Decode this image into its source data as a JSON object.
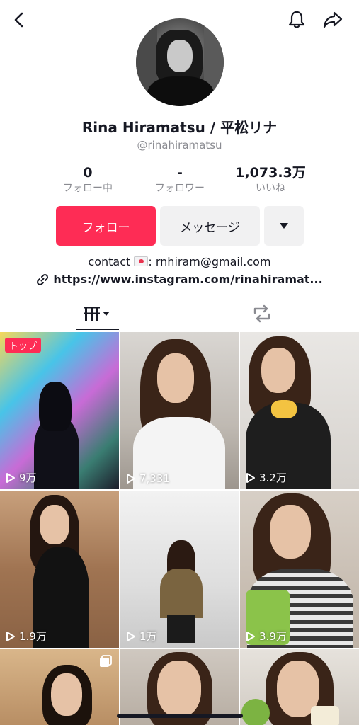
{
  "nav": {
    "back_icon": "chevron-left-icon",
    "bell_icon": "bell-icon",
    "share_icon": "share-icon"
  },
  "profile": {
    "name": "Rina Hiramatsu / 平松リナ",
    "handle": "@rinahiramatsu",
    "stats": [
      {
        "value": "0",
        "label": "フォロー中"
      },
      {
        "value": "-",
        "label": "フォロワー"
      },
      {
        "value": "1,073.3万",
        "label": "いいね"
      }
    ],
    "buttons": {
      "follow": "フォロー",
      "message": "メッセージ"
    },
    "bio": {
      "prefix": "contact ",
      "suffix": ": rnhiram@gmail.com"
    },
    "link": "https://www.instagram.com/rinahiramat..."
  },
  "colors": {
    "accent": "#fe2c55",
    "text": "#161823",
    "muted": "#8a8b91",
    "button_bg": "#f1f1f2"
  },
  "tabs": [
    {
      "name": "videos",
      "icon": "grid-icon",
      "active": true
    },
    {
      "name": "reposts",
      "icon": "repost-icon",
      "active": false
    }
  ],
  "videos": [
    {
      "views": "9万",
      "badge": "トップ"
    },
    {
      "views": "7,331"
    },
    {
      "views": "3.2万"
    },
    {
      "views": "1.9万"
    },
    {
      "views": "1万"
    },
    {
      "views": "3.9万"
    },
    {
      "views": ""
    },
    {
      "views": ""
    },
    {
      "views": ""
    }
  ]
}
